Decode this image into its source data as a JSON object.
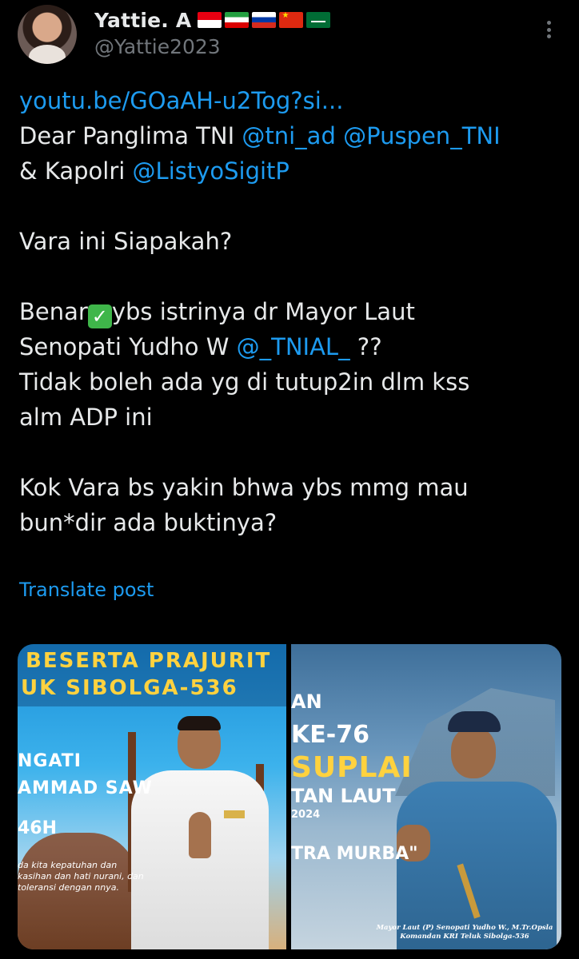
{
  "author": {
    "display_name": "Yattie. A",
    "handle": "@Yattie2023",
    "flags": [
      "flag-indonesia-icon",
      "flag-iran-icon",
      "flag-russia-icon",
      "flag-china-icon",
      "flag-saudi-arabia-icon"
    ]
  },
  "tweet": {
    "link": "youtu.be/GOaAH-u2Tog?si...",
    "line1_text": "Dear Panglima TNI ",
    "mention1": "@tni_ad",
    "mention2": "@Puspen_TNI",
    "line2_text": "& Kapolri ",
    "mention3": "@ListyoSigitP",
    "para2": "Vara ini Siapakah?",
    "para3_a": "Benar",
    "para3_b": "ybs istrinya dr Mayor Laut",
    "para3_c": "Senopati Yudho W ",
    "mention4": "@_TNIAL_",
    "para3_d": " ??",
    "para3_e": "Tidak boleh ada yg di tutup2in dlm kss",
    "para3_f": "alm ADP ini",
    "para4_a": "Kok Vara bs yakin bhwa ybs mmg mau",
    "para4_b": "bun*dir ada buktinya?",
    "translate_label": "Translate post",
    "check_glyph": "✓"
  },
  "media": {
    "left": {
      "line1": "BESERTA PRAJURIT",
      "line2": "UK SIBOLGA-536",
      "line3": "NGATI",
      "line4": "AMMAD SAW",
      "line5": "46H",
      "small_text": "da kita kepatuhan dan kasihan dan hati nurani, dan toleransi dengan nnya."
    },
    "right": {
      "line1": "AN",
      "line2": "KE-76",
      "line3": "SUPLAI",
      "line4": "TAN LAUT",
      "line5": "2024",
      "line6": "TRA MURBA\"",
      "caption": "Mayor Laut (P) Senopati Yudho W., M.Tr.Opsla Komandan KRI Teluk Sibolga-536"
    }
  },
  "colors": {
    "background": "#000000",
    "text": "#e7e9ea",
    "secondary": "#71767b",
    "link": "#1d9bf0",
    "check": "#3fb64a"
  }
}
